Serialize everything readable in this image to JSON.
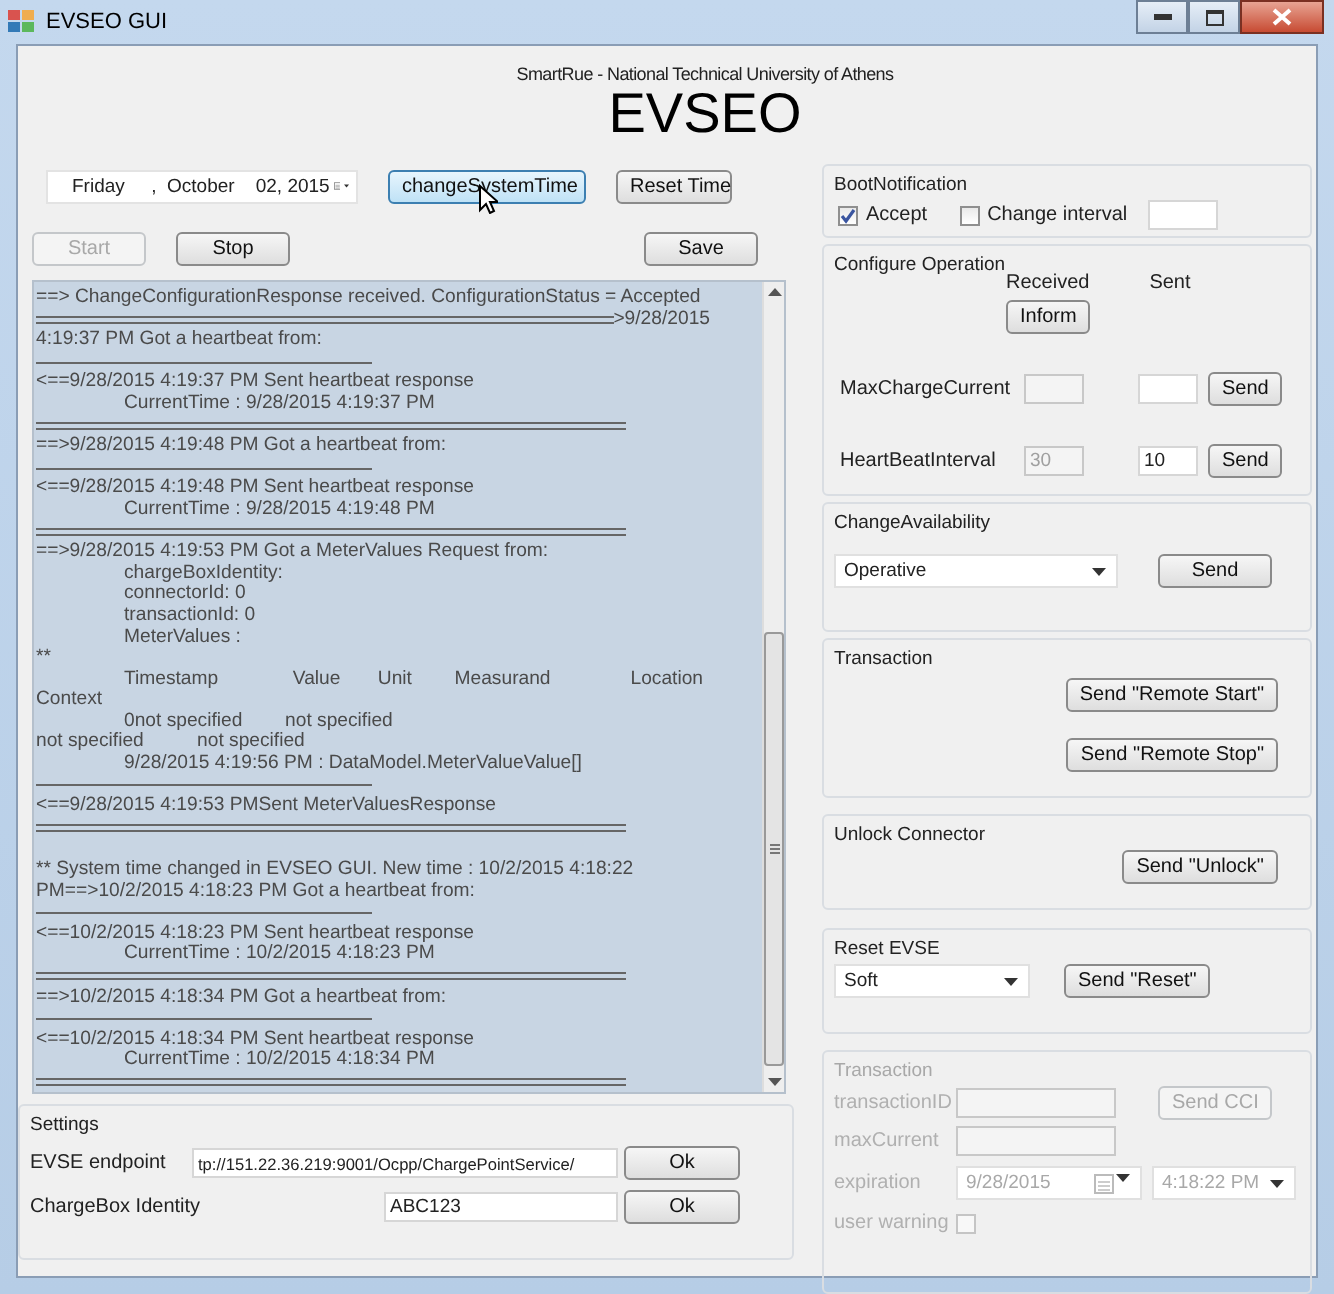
{
  "window": {
    "title": "EVSEO GUI"
  },
  "header": {
    "subtitle": "SmartRue - National Technical University of Athens",
    "title": "EVSEO"
  },
  "date_picker": {
    "value": "Friday     ,  October    02, 2015"
  },
  "time_buttons": [
    {
      "label": "changeSystemTime",
      "hovered": true
    },
    {
      "label": "Reset Time",
      "hovered": false
    }
  ],
  "action_buttons": [
    {
      "label": "Start",
      "disabled": true
    },
    {
      "label": "Stop",
      "disabled": false
    },
    {
      "label": "Save",
      "disabled": false
    }
  ],
  "log": {
    "lines": [
      {
        "kind": "text",
        "text": "==> ChangeConfigurationResponse received. ConfigurationStatus = Accepted"
      },
      {
        "kind": "rule_text",
        "text": ">9/28/2015"
      },
      {
        "kind": "text",
        "text": "4:19:37 PM Got a heartbeat from:"
      },
      {
        "kind": "single_rule"
      },
      {
        "kind": "text",
        "text": "<==9/28/2015 4:19:37 PM Sent heartbeat response"
      },
      {
        "kind": "indented",
        "text": "CurrentTime : 9/28/2015 4:19:37 PM"
      },
      {
        "kind": "double_rule"
      },
      {
        "kind": "text",
        "text": "==>9/28/2015 4:19:48 PM Got a heartbeat from:"
      },
      {
        "kind": "single_rule"
      },
      {
        "kind": "text",
        "text": "<==9/28/2015 4:19:48 PM Sent heartbeat response"
      },
      {
        "kind": "indented",
        "text": "CurrentTime : 9/28/2015 4:19:48 PM"
      },
      {
        "kind": "double_rule"
      },
      {
        "kind": "text",
        "text": "==>9/28/2015 4:19:53 PM Got a MeterValues Request from:"
      },
      {
        "kind": "indented",
        "text": "chargeBoxIdentity:"
      },
      {
        "kind": "indented",
        "text": "connectorId: 0"
      },
      {
        "kind": "indented",
        "text": "transactionId: 0"
      },
      {
        "kind": "indented",
        "text": "MeterValues :"
      },
      {
        "kind": "text",
        "text": "**"
      },
      {
        "kind": "indented",
        "text": "Timestamp              Value       Unit        Measurand               Location"
      },
      {
        "kind": "text",
        "text": "Context"
      },
      {
        "kind": "indented",
        "text": "0not specified        not specified"
      },
      {
        "kind": "text",
        "text": "not specified          not specified"
      },
      {
        "kind": "indented",
        "text": "9/28/2015 4:19:56 PM : DataModel.MeterValueValue[]"
      },
      {
        "kind": "single_rule"
      },
      {
        "kind": "text",
        "text": "<==9/28/2015 4:19:53 PMSent MeterValuesResponse"
      },
      {
        "kind": "double_rule"
      },
      {
        "kind": "blank"
      },
      {
        "kind": "text",
        "text": "** System time changed in EVSEO GUI. New time : 10/2/2015 4:18:22"
      },
      {
        "kind": "text",
        "text": "PM==>10/2/2015 4:18:23 PM Got a heartbeat from:"
      },
      {
        "kind": "single_rule"
      },
      {
        "kind": "text",
        "text": "<==10/2/2015 4:18:23 PM Sent heartbeat response"
      },
      {
        "kind": "indented",
        "text": "CurrentTime : 10/2/2015 4:18:23 PM"
      },
      {
        "kind": "double_rule"
      },
      {
        "kind": "text",
        "text": "==>10/2/2015 4:18:34 PM Got a heartbeat from:"
      },
      {
        "kind": "single_rule"
      },
      {
        "kind": "text",
        "text": "<==10/2/2015 4:18:34 PM Sent heartbeat response"
      },
      {
        "kind": "indented",
        "text": "CurrentTime : 10/2/2015 4:18:34 PM"
      },
      {
        "kind": "double_rule"
      }
    ]
  },
  "settings": {
    "title": "Settings",
    "fields": [
      {
        "label": "EVSE endpoint",
        "value": "tp://151.22.36.219:9001/Ocpp/ChargePointService/",
        "button": "Ok"
      },
      {
        "label": "ChargeBox Identity",
        "value": "ABC123",
        "button": "Ok"
      }
    ]
  },
  "boot_notification": {
    "title": "BootNotification",
    "options": [
      {
        "label": "Accept",
        "checked": true
      },
      {
        "label": "Change interval",
        "checked": false
      }
    ]
  },
  "configure_operation": {
    "title": "Configure Operation",
    "received_header": "Received",
    "sent_header": "Sent",
    "inform_button": "Inform",
    "rows": [
      {
        "label": "MaxChargeCurrent",
        "button": "Send"
      },
      {
        "label": "HeartBeatInterval",
        "received": "30",
        "sent": "10",
        "button": "Send"
      }
    ]
  },
  "change_availability": {
    "title": "ChangeAvailability",
    "selection": "Operative",
    "button": "Send"
  },
  "transaction": {
    "title": "Transaction",
    "buttons": [
      "Send \"Remote Start\"",
      "Send \"Remote Stop\""
    ]
  },
  "unlock_connector": {
    "title": "Unlock Connector",
    "button": "Send \"Unlock\""
  },
  "reset_evse": {
    "title": "Reset EVSE",
    "selection": "Soft",
    "button": "Send \"Reset\""
  },
  "charging_transaction": {
    "title": "Transaction",
    "disabled": true,
    "transaction_id_label": "transactionID",
    "max_current_label": "maxCurrent",
    "button": "Send CCI",
    "expiration_label": "expiration",
    "expiration_date": "9/28/2015",
    "expiration_time": "4:18:22 PM",
    "user_warning_label": "user warning",
    "user_warning": false
  }
}
